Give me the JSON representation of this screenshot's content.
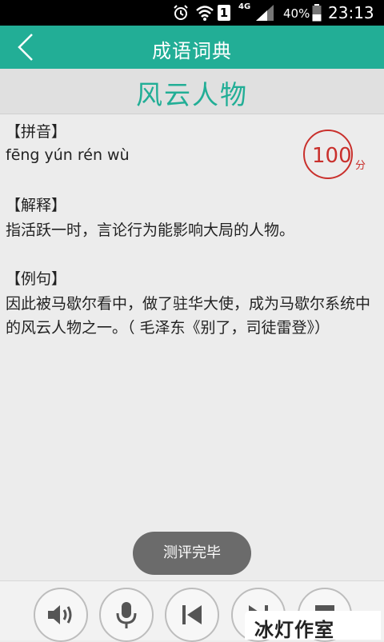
{
  "status_bar": {
    "sim_label": "1",
    "network": "4G",
    "battery_percent": "40%",
    "time": "23:13"
  },
  "app_bar": {
    "title": "成语词典",
    "back_icon": "chevron-left-icon"
  },
  "idiom": {
    "word": "风云人物",
    "pinyin_label": "【拼音】",
    "pinyin": "fēng yún rén wù",
    "explain_label": "【解释】",
    "explain": "指活跃一时，言论行为能影响大局的人物。",
    "example_label": "【例句】",
    "example": "因此被马歇尔看中，做了驻华大使，成为马歇尔系统中的风云人物之一。（ 毛泽东《别了，司徒雷登》）"
  },
  "score": {
    "value": "100",
    "unit": "分"
  },
  "toast": {
    "text": "测评完毕"
  },
  "toolbar": {
    "buttons": [
      "speaker-icon",
      "microphone-icon",
      "skip-previous-icon",
      "skip-next-icon",
      "stop-icon"
    ]
  },
  "watermark": {
    "text": "冰灯作室"
  },
  "colors": {
    "accent": "#22ae96",
    "score": "#c9302c",
    "status_bar": "#000000"
  }
}
